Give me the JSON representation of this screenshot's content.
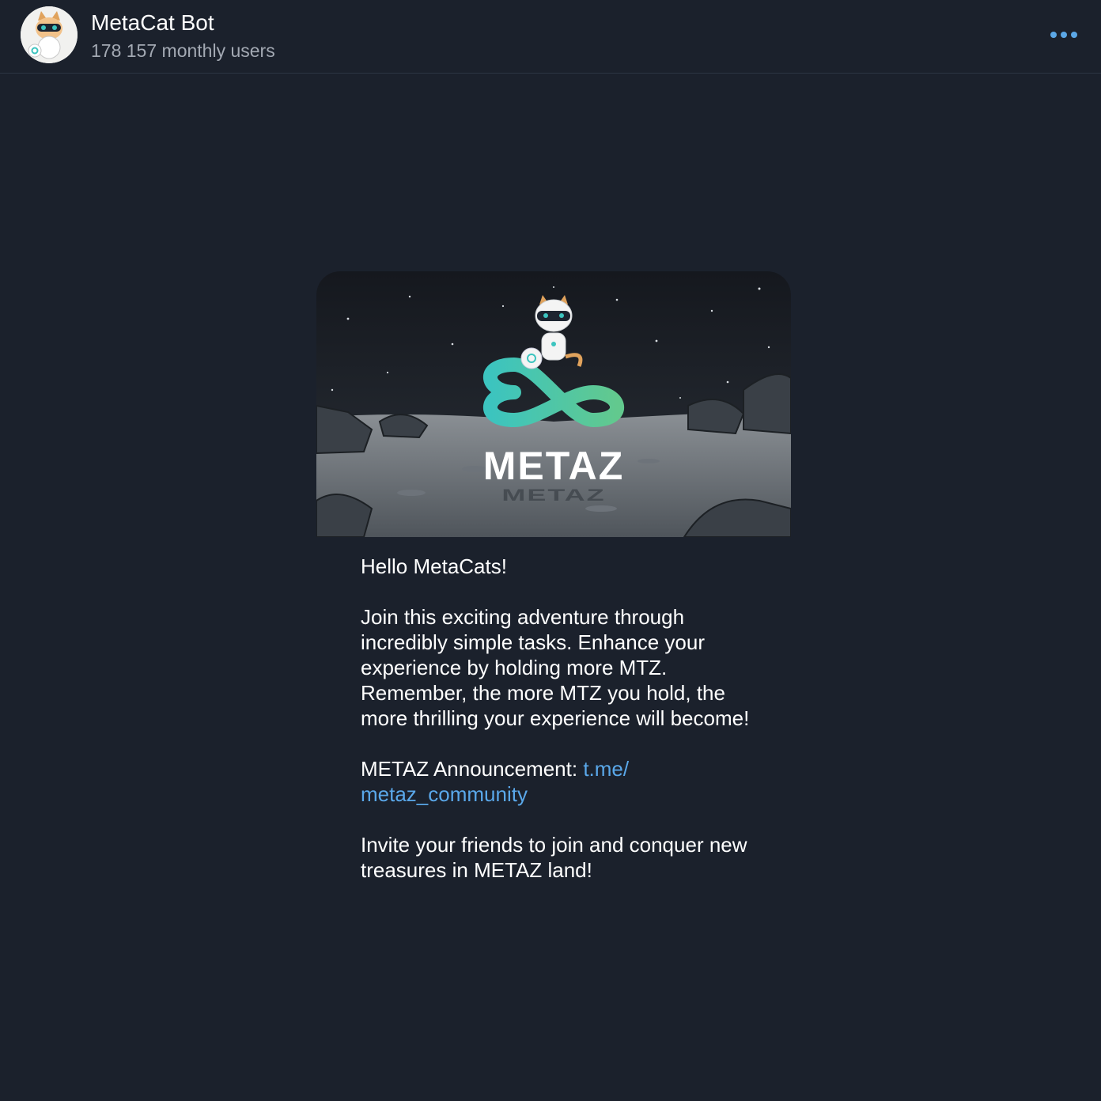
{
  "header": {
    "bot_name": "MetaCat Bot",
    "monthly_users": "178 157 monthly users"
  },
  "banner": {
    "logo_text": "METAZ"
  },
  "message": {
    "greeting": "Hello MetaCats!",
    "body": "Join this exciting adventure through incredibly simple tasks. Enhance your experience by holding more MTZ. Remember, the more MTZ you hold, the more thrilling your experience will become!",
    "announcement_label": "METAZ Announcement: ",
    "announcement_link": "t.me/\nmetaz_community",
    "closing": "Invite your friends to join and conquer new treasures in METAZ land!"
  },
  "colors": {
    "background": "#1b212c",
    "link": "#5aa8ea",
    "accent_dots": "#5ba7e6",
    "muted_text": "#a3a9b3",
    "logo_teal": "#3cc4bf",
    "logo_green": "#62c98e"
  }
}
